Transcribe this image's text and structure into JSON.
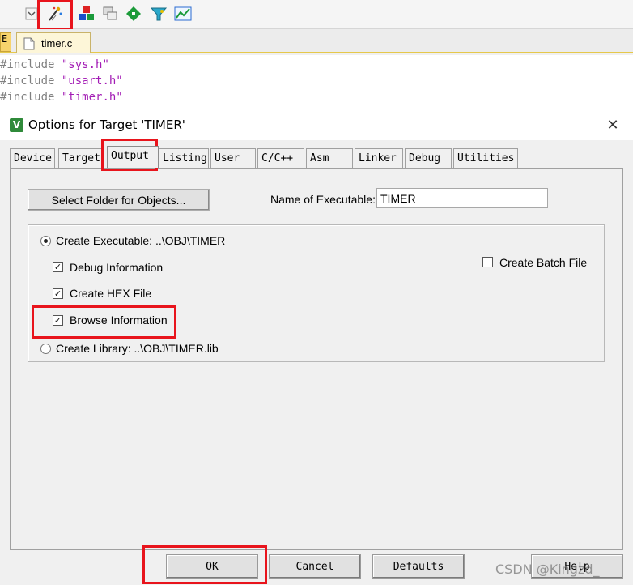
{
  "editor": {
    "tab_left_label": "E",
    "file_tab": "timer.c",
    "code_lines": [
      {
        "kw": "#include",
        "str": "\"sys.h\""
      },
      {
        "kw": "#include",
        "str": "\"usart.h\""
      },
      {
        "kw": "#include",
        "str": "\"timer.h\""
      }
    ]
  },
  "toolbar": {
    "icons": [
      "dropdown-icon",
      "magic-wand-icon",
      "target-icon",
      "copy-icon",
      "diamond-icon",
      "funnel-icon",
      "chart-icon"
    ]
  },
  "dialog": {
    "title": "Options for Target 'TIMER'",
    "close_glyph": "✕",
    "icon_letter": "V",
    "tabs": [
      "Device",
      "Target",
      "Output",
      "Listing",
      "User",
      "C/C++",
      "Asm",
      "Linker",
      "Debug",
      "Utilities"
    ],
    "active_tab": "Output",
    "select_folder_button": "Select Folder for Objects...",
    "name_exe_label": "Name of Executable:",
    "name_exe_value": "TIMER",
    "create_exe_label": "Create Executable:  ..\\OBJ\\TIMER",
    "debug_info_label": "Debug Information",
    "create_hex_label": "Create HEX File",
    "browse_info_label": "Browse Information",
    "create_lib_label": "Create Library:  ..\\OBJ\\TIMER.lib",
    "create_batch_label": "Create Batch File",
    "check_glyph": "✓",
    "footer": {
      "ok": "OK",
      "cancel": "Cancel",
      "defaults": "Defaults",
      "help": "Help"
    }
  },
  "watermark": "CSDN @Kingzd_",
  "colors": {
    "highlight": "#e8141c",
    "string": "#a31db5",
    "tab_accent": "#f7d36c"
  }
}
